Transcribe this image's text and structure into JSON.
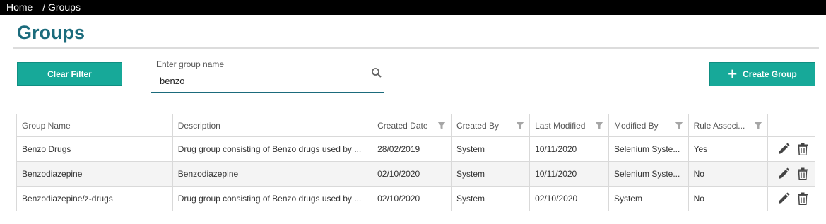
{
  "breadcrumb": {
    "home": "Home",
    "current": "/ Groups"
  },
  "page_title": "Groups",
  "toolbar": {
    "clear_filter_label": "Clear Filter",
    "create_group_label": "Create Group"
  },
  "search": {
    "label": "Enter group name",
    "value": "benzo"
  },
  "table": {
    "columns": [
      "Group Name",
      "Description",
      "Created Date",
      "Created By",
      "Last Modified",
      "Modified By",
      "Rule Associ..."
    ],
    "rows": [
      {
        "name": "Benzo Drugs",
        "description": "Drug group consisting of Benzo drugs used by ...",
        "created_date": "28/02/2019",
        "created_by": "System",
        "last_modified": "10/11/2020",
        "modified_by": "Selenium Syste...",
        "rule": "Yes"
      },
      {
        "name": "Benzodiazepine",
        "description": "Benzodiazepine",
        "created_date": "02/10/2020",
        "created_by": "System",
        "last_modified": "10/11/2020",
        "modified_by": "Selenium Syste...",
        "rule": "No"
      },
      {
        "name": "Benzodiazepine/z-drugs",
        "description": "Drug group consisting of Benzo drugs used by ...",
        "created_date": "02/10/2020",
        "created_by": "System",
        "last_modified": "02/10/2020",
        "modified_by": "System",
        "rule": "No"
      }
    ]
  },
  "colors": {
    "accent": "#17a999",
    "title": "#1b6b7c"
  },
  "icons": {
    "search": "search-icon",
    "filter": "filter-icon",
    "edit": "pencil-icon",
    "delete": "trash-icon"
  }
}
